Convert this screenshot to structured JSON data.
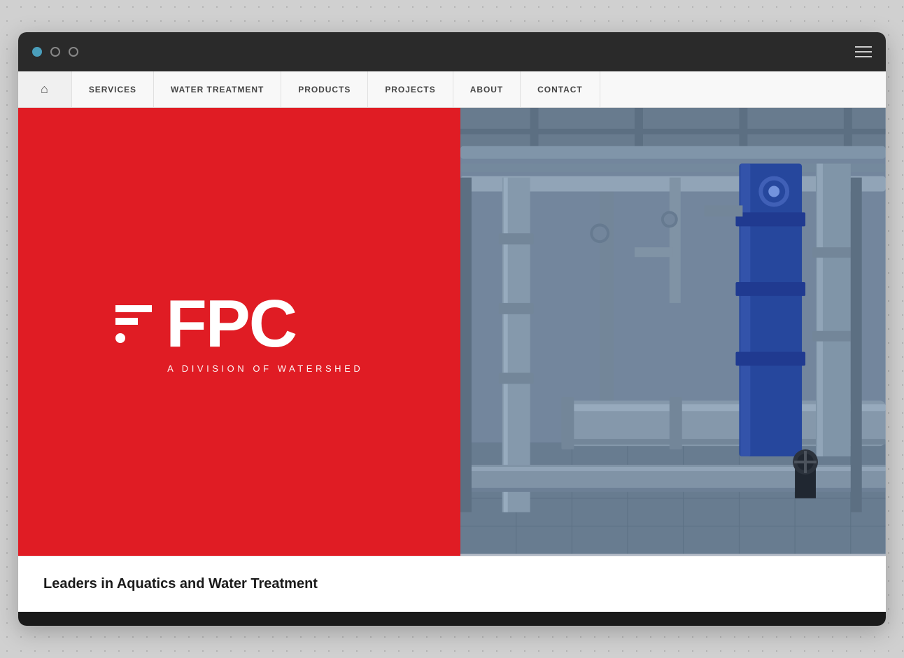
{
  "browser": {
    "dots": [
      "blue",
      "outline",
      "outline"
    ]
  },
  "nav": {
    "home_label": "🏠",
    "items": [
      {
        "id": "services",
        "label": "SERVICES"
      },
      {
        "id": "water-treatment",
        "label": "WATER TREATMENT"
      },
      {
        "id": "products",
        "label": "PRODUCTS"
      },
      {
        "id": "projects",
        "label": "PROJECTS"
      },
      {
        "id": "about",
        "label": "ABOUT"
      },
      {
        "id": "contact",
        "label": "CONTACT"
      }
    ]
  },
  "hero": {
    "logo": {
      "main_text": "FPC",
      "subtitle": "A DIVISION OF WATERSHED"
    }
  },
  "bottom": {
    "title": "Leaders in Aquatics and Water Treatment"
  },
  "colors": {
    "red": "#e01c24",
    "dark": "#1a1a1a",
    "nav_bg": "#f8f8f8"
  }
}
